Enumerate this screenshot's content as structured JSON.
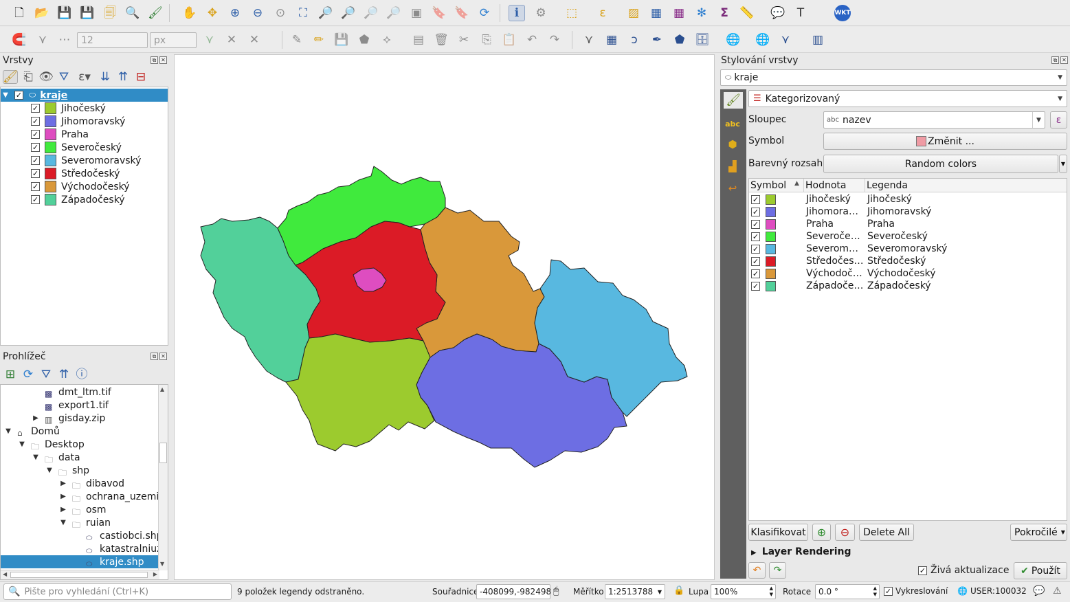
{
  "toolbar": {
    "snap_tolerance": "12",
    "snap_unit": "px",
    "wkt_label": "WKT"
  },
  "layers_panel": {
    "title": "Vrstvy",
    "layer_name": "kraje",
    "categories": [
      {
        "label": "Jihočeský",
        "color": "#9ccb2e"
      },
      {
        "label": "Jihomoravský",
        "color": "#6d6ee3"
      },
      {
        "label": "Praha",
        "color": "#de4dc0"
      },
      {
        "label": "Severočeský",
        "color": "#40ea3d"
      },
      {
        "label": "Severomoravský",
        "color": "#58b8e0"
      },
      {
        "label": "Středočeský",
        "color": "#db1b26"
      },
      {
        "label": "Východočeský",
        "color": "#d9983a"
      },
      {
        "label": "Západočeský",
        "color": "#52d09a"
      }
    ]
  },
  "browser_panel": {
    "title": "Prohlížeč",
    "items": [
      {
        "label": "dmt_ltm.tif",
        "indent": 0,
        "icon": "raster-icon",
        "arrow": ""
      },
      {
        "label": "export1.tif",
        "indent": 0,
        "icon": "raster-icon",
        "arrow": ""
      },
      {
        "label": "gisday.zip",
        "indent": 0,
        "icon": "zip-icon",
        "arrow": "▶"
      },
      {
        "label": "Domů",
        "indent": -2,
        "icon": "home-folder-icon",
        "arrow": "▼"
      },
      {
        "label": "Desktop",
        "indent": -1,
        "icon": "folder-icon",
        "arrow": "▼"
      },
      {
        "label": "data",
        "indent": 0,
        "icon": "folder-icon",
        "arrow": "▼"
      },
      {
        "label": "shp",
        "indent": 1,
        "icon": "folder-icon",
        "arrow": "▼"
      },
      {
        "label": "dibavod",
        "indent": 2,
        "icon": "folder-icon",
        "arrow": "▶"
      },
      {
        "label": "ochrana_uzemi",
        "indent": 2,
        "icon": "folder-icon",
        "arrow": "▶"
      },
      {
        "label": "osm",
        "indent": 2,
        "icon": "folder-icon",
        "arrow": "▶"
      },
      {
        "label": "ruian",
        "indent": 2,
        "icon": "folder-icon",
        "arrow": "▼"
      },
      {
        "label": "castiobci.shp",
        "indent": 3,
        "icon": "polygon-layer-icon",
        "arrow": ""
      },
      {
        "label": "katastralniuz",
        "indent": 3,
        "icon": "polygon-layer-icon",
        "arrow": ""
      },
      {
        "label": "kraje.shp",
        "indent": 3,
        "icon": "polygon-layer-icon",
        "arrow": "",
        "selected": true
      }
    ]
  },
  "styling_panel": {
    "title": "Stylování vrstvy",
    "layer_select": "kraje",
    "renderer": "Kategorizovaný",
    "column_label": "Sloupec",
    "column_value": "nazev",
    "column_type": "abc",
    "symbol_label": "Symbol",
    "symbol_button": "Změnit ...",
    "ramp_label": "Barevný rozsah",
    "ramp_value": "Random colors",
    "table_headers": [
      "Symbol",
      "Hodnota",
      "Legenda"
    ],
    "rows": [
      {
        "value": "Jihočeský",
        "legend": "Jihočeský",
        "color": "#9ccb2e"
      },
      {
        "value": "Jihomora…",
        "legend": "Jihomoravský",
        "color": "#6d6ee3"
      },
      {
        "value": "Praha",
        "legend": "Praha",
        "color": "#de4dc0"
      },
      {
        "value": "Severoče…",
        "legend": "Severočeský",
        "color": "#40ea3d"
      },
      {
        "value": "Severom…",
        "legend": "Severomoravský",
        "color": "#58b8e0"
      },
      {
        "value": "Středočes…",
        "legend": "Středočeský",
        "color": "#db1b26"
      },
      {
        "value": "Východoč…",
        "legend": "Východočeský",
        "color": "#d9983a"
      },
      {
        "value": "Západoče…",
        "legend": "Západočeský",
        "color": "#52d09a"
      }
    ],
    "classify_button": "Klasifikovat",
    "delete_all_button": "Delete All",
    "advanced_button": "Pokročilé",
    "layer_rendering": "Layer Rendering",
    "live_update": "Živá aktualizace",
    "apply_button": "Použít"
  },
  "statusbar": {
    "search_placeholder": "Pište pro vyhledání (Ctrl+K)",
    "message": "9 položek legendy odstraněno.",
    "coord_label": "Souřadnice",
    "coord_value": "-408099,-982498",
    "scale_label": "Měřítko",
    "scale_value": "1:2513788",
    "zoom_label": "Lupa",
    "zoom_value": "100%",
    "rotation_label": "Rotace",
    "rotation_value": "0.0 °",
    "render_label": "Vykreslování",
    "crs_value": "USER:100032"
  }
}
